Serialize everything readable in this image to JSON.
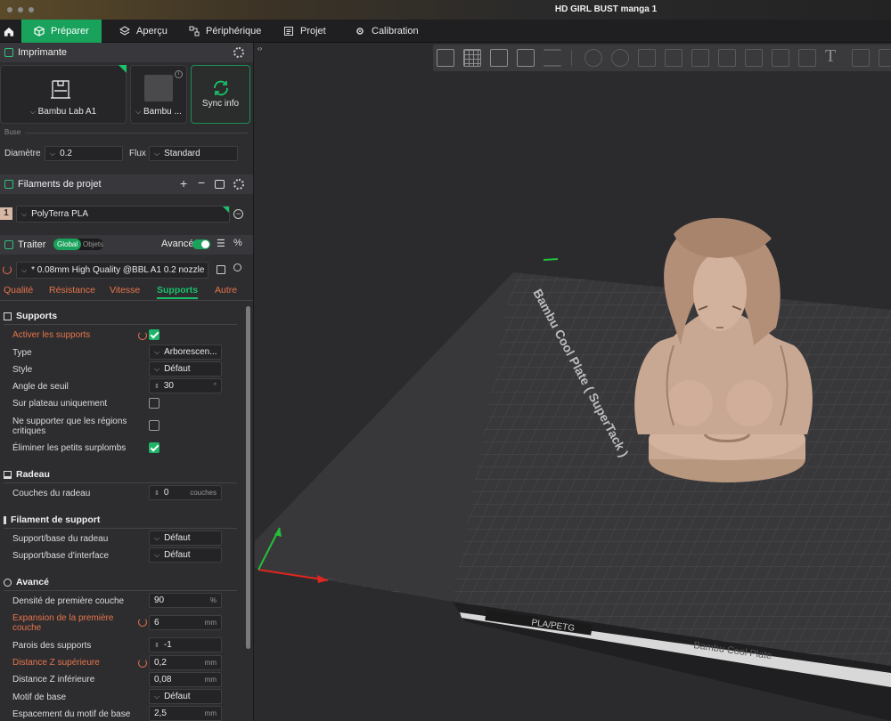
{
  "window": {
    "title": "HD GIRL BUST manga 1"
  },
  "tabs": [
    {
      "label": "Préparer",
      "icon": "cube-icon",
      "active": true
    },
    {
      "label": "Aperçu",
      "icon": "layers-icon"
    },
    {
      "label": "Périphérique",
      "icon": "device-icon"
    },
    {
      "label": "Projet",
      "icon": "project-icon"
    },
    {
      "label": "Calibration",
      "icon": "calibration-icon"
    }
  ],
  "printer": {
    "section_title": "Imprimante",
    "printer_name": "Bambu Lab A1",
    "plate_name": "Bambu ...",
    "sync_label": "Sync info",
    "nozzle_group": "Buse",
    "diameter_label": "Diamètre",
    "diameter_value": "0.2",
    "flow_label": "Flux",
    "flow_value": "Standard"
  },
  "filaments": {
    "section_title": "Filaments de projet",
    "items": [
      {
        "index": "1",
        "name": "PolyTerra PLA",
        "color": "#d8b8a4"
      }
    ]
  },
  "process": {
    "section_title": "Traiter",
    "toggle_global": "Global",
    "toggle_objects": "Objets",
    "advanced_label": "Avancé",
    "preset": "* 0.08mm High Quality @BBL A1 0.2 nozzle",
    "subtabs": [
      "Qualité",
      "Résistance",
      "Vitesse",
      "Supports",
      "Autre"
    ],
    "active_subtab": "Supports"
  },
  "supports": {
    "group_title": "Supports",
    "enable_label": "Activer les supports",
    "enable_checked": true,
    "type_label": "Type",
    "type_value": "Arborescen...",
    "style_label": "Style",
    "style_value": "Défaut",
    "threshold_label": "Angle de seuil",
    "threshold_value": "30",
    "threshold_unit": "°",
    "on_plate_label": "Sur plateau uniquement",
    "on_plate_checked": false,
    "critical_label_1": "Ne supporter que les régions",
    "critical_label_2": "critiques",
    "critical_checked": false,
    "remove_small_label": "Éliminer les petits surplombs",
    "remove_small_checked": true
  },
  "raft": {
    "group_title": "Radeau",
    "layers_label": "Couches du radeau",
    "layers_value": "0",
    "layers_unit": "couches"
  },
  "support_filament": {
    "group_title": "Filament de support",
    "base_label": "Support/base du radeau",
    "base_value": "Défaut",
    "interface_label": "Support/base d'interface",
    "interface_value": "Défaut"
  },
  "advanced": {
    "group_title": "Avancé",
    "first_layer_density_label": "Densité de première couche",
    "first_layer_density_value": "90",
    "first_layer_density_unit": "%",
    "first_layer_exp_label_1": "Expansion de la première",
    "first_layer_exp_label_2": "couche",
    "first_layer_exp_value": "6",
    "mm": "mm",
    "wall_loops_label": "Parois des supports",
    "wall_loops_value": "-1",
    "top_z_label": "Distance Z supérieure",
    "top_z_value": "0,2",
    "bottom_z_label": "Distance Z inférieure",
    "bottom_z_value": "0,08",
    "base_pattern_label": "Motif de base",
    "base_pattern_value": "Défaut",
    "base_spacing_label": "Espacement du motif de base",
    "base_spacing_value": "2,5"
  },
  "viewport": {
    "plate_label": "Bambu Cool Plate ( SuperTack )",
    "plate_footer": "Bambu Cool Plate",
    "plate_tag": "PLA/PETG",
    "model_color": "#c9a893",
    "plate_color": "#38383a",
    "grid_color": "#4c4c4f"
  }
}
